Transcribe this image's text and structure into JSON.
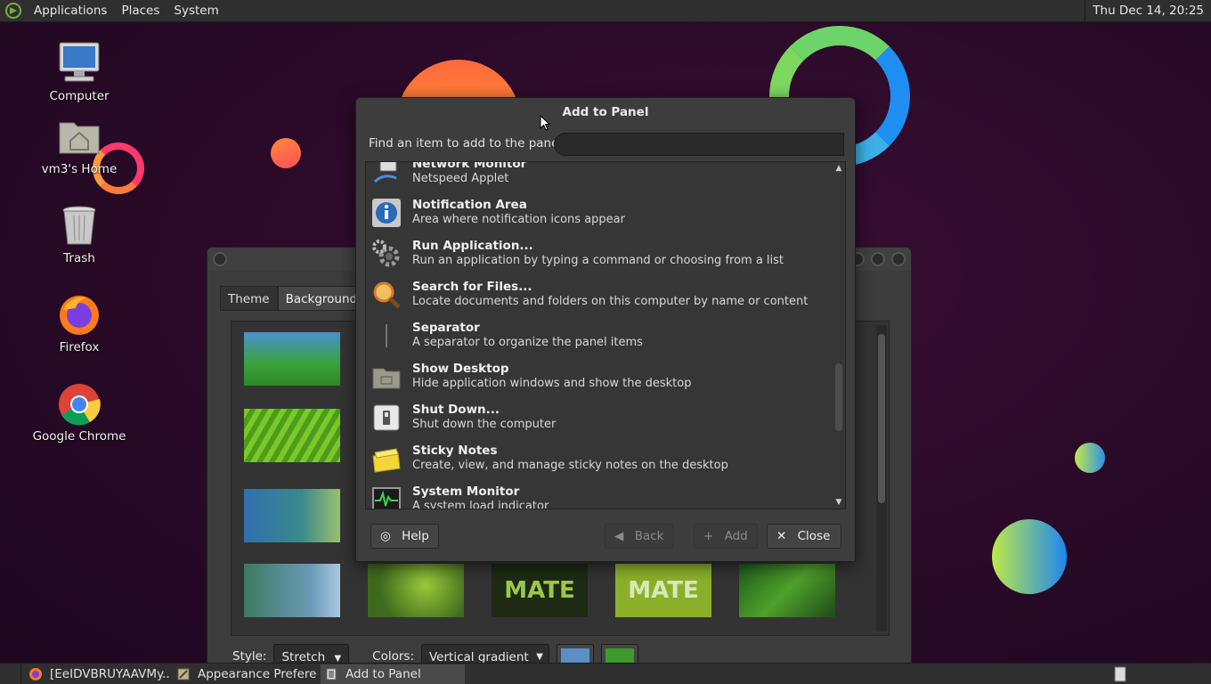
{
  "top_panel": {
    "menus": [
      "Applications",
      "Places",
      "System"
    ],
    "clock": "Thu Dec 14, 20:25"
  },
  "desktop_icons": [
    {
      "label": "Computer",
      "icon": "computer-icon"
    },
    {
      "label": "vm3's Home",
      "icon": "home-folder-icon"
    },
    {
      "label": "Trash",
      "icon": "trash-icon"
    },
    {
      "label": "Firefox",
      "icon": "firefox-icon"
    },
    {
      "label": "Google Chrome",
      "icon": "chrome-icon"
    }
  ],
  "appearance_window": {
    "tabs": [
      "Theme",
      "Background"
    ],
    "active_tab": "Background",
    "style_label": "Style:",
    "style_value": "Stretch",
    "colors_label": "Colors:",
    "colors_value": "Vertical gradient",
    "color_primary": "#5b8fc4",
    "color_secondary": "#3f9a2c",
    "mate_text": "MATE"
  },
  "dialog": {
    "title": "Add to Panel",
    "find_label": "Find an item to add to the panel:",
    "search_value": "",
    "items": [
      {
        "name": "Network Monitor",
        "desc": "Netspeed Applet",
        "icon": "network-monitor-icon"
      },
      {
        "name": "Notification Area",
        "desc": "Area where notification icons appear",
        "icon": "info-icon"
      },
      {
        "name": "Run Application...",
        "desc": "Run an application by typing a command or choosing from a list",
        "icon": "gears-icon"
      },
      {
        "name": "Search for Files...",
        "desc": "Locate documents and folders on this computer by name or content",
        "icon": "magnifier-icon"
      },
      {
        "name": "Separator",
        "desc": "A separator to organize the panel items",
        "icon": "separator-icon"
      },
      {
        "name": "Show Desktop",
        "desc": "Hide application windows and show the desktop",
        "icon": "show-desktop-icon"
      },
      {
        "name": "Shut Down...",
        "desc": "Shut down the computer",
        "icon": "shutdown-icon"
      },
      {
        "name": "Sticky Notes",
        "desc": "Create, view, and manage sticky notes on the desktop",
        "icon": "sticky-notes-icon"
      },
      {
        "name": "System Monitor",
        "desc": "A system load indicator",
        "icon": "system-monitor-icon"
      }
    ],
    "buttons": {
      "help": "Help",
      "back": "Back",
      "add": "Add",
      "close": "Close"
    }
  },
  "taskbar": [
    {
      "label": "[EeIDVBRUYAAVMy...",
      "icon": "firefox-icon"
    },
    {
      "label": "Appearance Prefere...",
      "icon": "appearance-icon"
    },
    {
      "label": "Add to Panel",
      "icon": "panel-icon"
    }
  ]
}
